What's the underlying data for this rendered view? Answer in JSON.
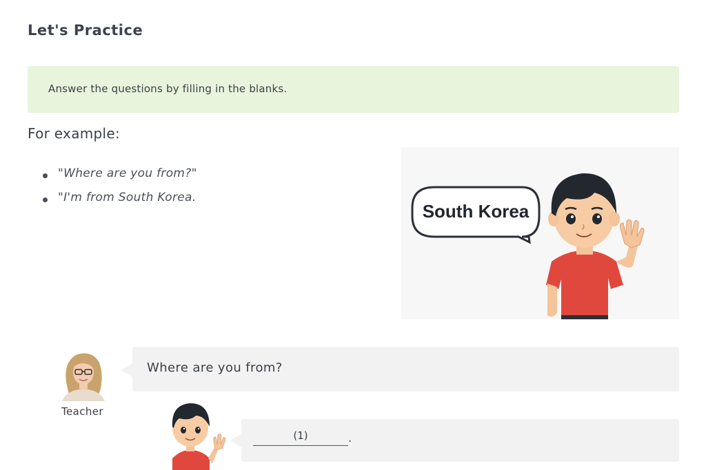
{
  "page": {
    "title": "Let's Practice"
  },
  "instruction": {
    "text": "Answer the questions by filling in the blanks."
  },
  "example": {
    "heading": "For example:",
    "items": [
      "\"Where are you from?\"",
      "\"I'm from South Korea."
    ],
    "illustration": {
      "speech_text": "South Korea"
    }
  },
  "dialogue": {
    "teacher": {
      "name": "Teacher",
      "line": "Where are you from?"
    },
    "student": {
      "blank_label": "(1)",
      "punctuation": "."
    }
  },
  "colors": {
    "instruction_bg": "#e8f5dc",
    "bubble_bg": "#f2f2f2",
    "shirt_red": "#e0483e",
    "hair_dark": "#23282f"
  }
}
